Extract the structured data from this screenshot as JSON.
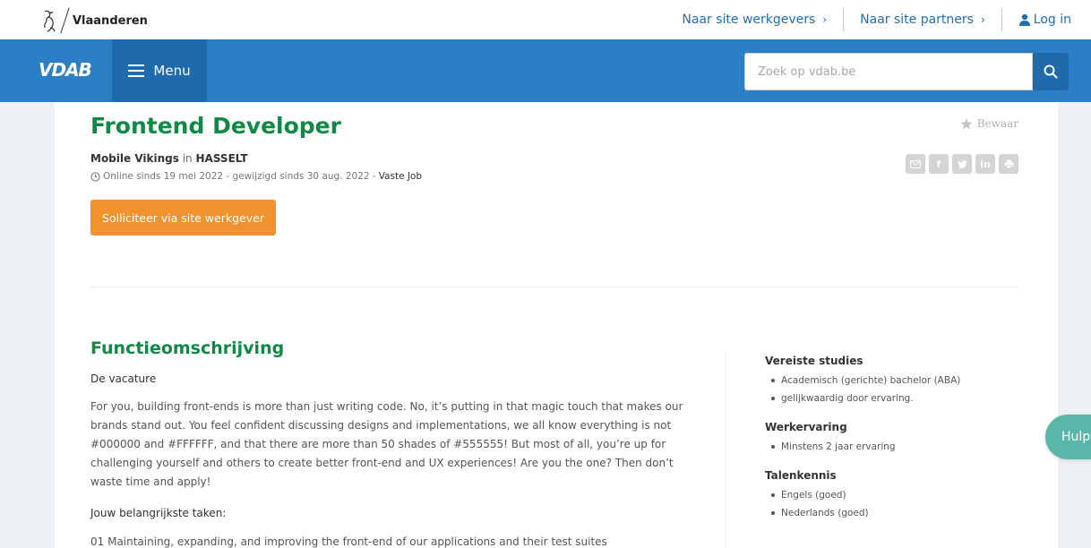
{
  "topbar": {
    "brand": "Vlaanderen",
    "links": [
      {
        "label": "Naar site werkgevers",
        "chevron": "›"
      },
      {
        "label": "Naar site partners",
        "chevron": "›"
      }
    ],
    "login_label": "Log in"
  },
  "nav": {
    "logo": "VDAB",
    "menu_label": "Menu",
    "search_placeholder": "Zoek op vdab.be",
    "search_value": ""
  },
  "job": {
    "title": "Frontend Developer",
    "save_label": "Bewaar",
    "company": "Mobile Vikings",
    "in_word": "in",
    "city": "HASSELT",
    "meta": "Online sinds 19 mei 2022 - gewijzigd sinds 30 aug. 2022 -",
    "job_type": "Vaste Job",
    "share": [
      "mail-icon",
      "facebook-icon",
      "twitter-icon",
      "linkedin-icon",
      "print-icon"
    ],
    "share_text": {
      "facebook": "f",
      "linkedin": "in"
    },
    "apply_label": "Solliciteer via site werkgever"
  },
  "description": {
    "section_title": "Functieomschrijving",
    "subtitle": "De vacature",
    "text": "For you, building front-ends is more than just writing code. No, it’s putting in that magic touch that makes our brands stand out. You feel confident discussing designs and implementations, we all know everything is not #000000 and #FFFFFF, and that there are more than 50 shades of #555555! But most of all, you’re up for challenging yourself and others to create better front-end and UX experiences! Are you the one? Then don’t waste time and apply!",
    "tasks_title": "Jouw belangrijkste taken:",
    "task_1": "01 Maintaining, expanding, and improving the front-end of our applications and their test suites"
  },
  "requirements": [
    {
      "title": "Vereiste studies",
      "items": [
        "Academisch (gerichte) bachelor (ABA)",
        "gelijkwaardig door ervaring."
      ]
    },
    {
      "title": "Werkervaring",
      "items": [
        "Minstens 2 jaar ervaring"
      ]
    },
    {
      "title": "Talenkennis",
      "items": [
        "Engels (goed)",
        "Nederlands (goed)"
      ]
    }
  ],
  "help": {
    "label": "Hulp"
  },
  "colors": {
    "brand_blue": "#2b80c5",
    "menu_blue": "#1f6aaa",
    "title_green": "#0f8a44",
    "apply_orange": "#f2922e",
    "help_teal": "#5bb5a9"
  }
}
